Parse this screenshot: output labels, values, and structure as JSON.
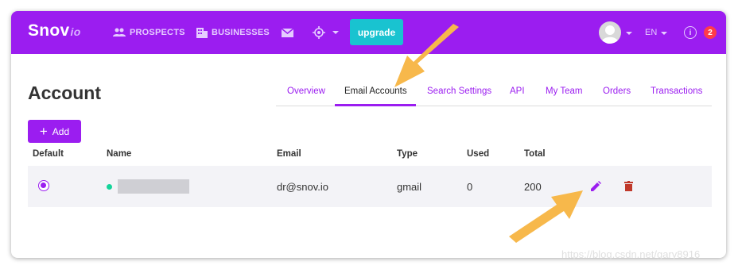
{
  "app": {
    "logo_main": "Snov",
    "logo_suffix": "io",
    "nav": {
      "prospects": "PROSPECTS",
      "businesses": "BUSINESSES",
      "upgrade": "upgrade",
      "language": "EN",
      "notifications_count": "2",
      "info_glyph": "i"
    }
  },
  "page": {
    "title": "Account",
    "tabs": [
      "Overview",
      "Email Accounts",
      "Search Settings",
      "API",
      "My Team",
      "Orders",
      "Transactions"
    ],
    "active_tab": "Email Accounts",
    "add_button": "Add"
  },
  "table": {
    "headers": {
      "default": "Default",
      "name": "Name",
      "email": "Email",
      "type": "Type",
      "used": "Used",
      "total": "Total"
    },
    "rows": [
      {
        "default_selected": true,
        "status": "active",
        "email": "dr@snov.io",
        "type": "gmail",
        "used": "0",
        "total": "200"
      }
    ]
  },
  "watermark": "https://blog.csdn.net/gary8916",
  "colors": {
    "brand_purple": "#9b1df0",
    "upgrade_cyan": "#19c3d0",
    "status_green": "#14d49a",
    "delete_red": "#c0392b",
    "annotation_arrow": "#f7b84b"
  }
}
